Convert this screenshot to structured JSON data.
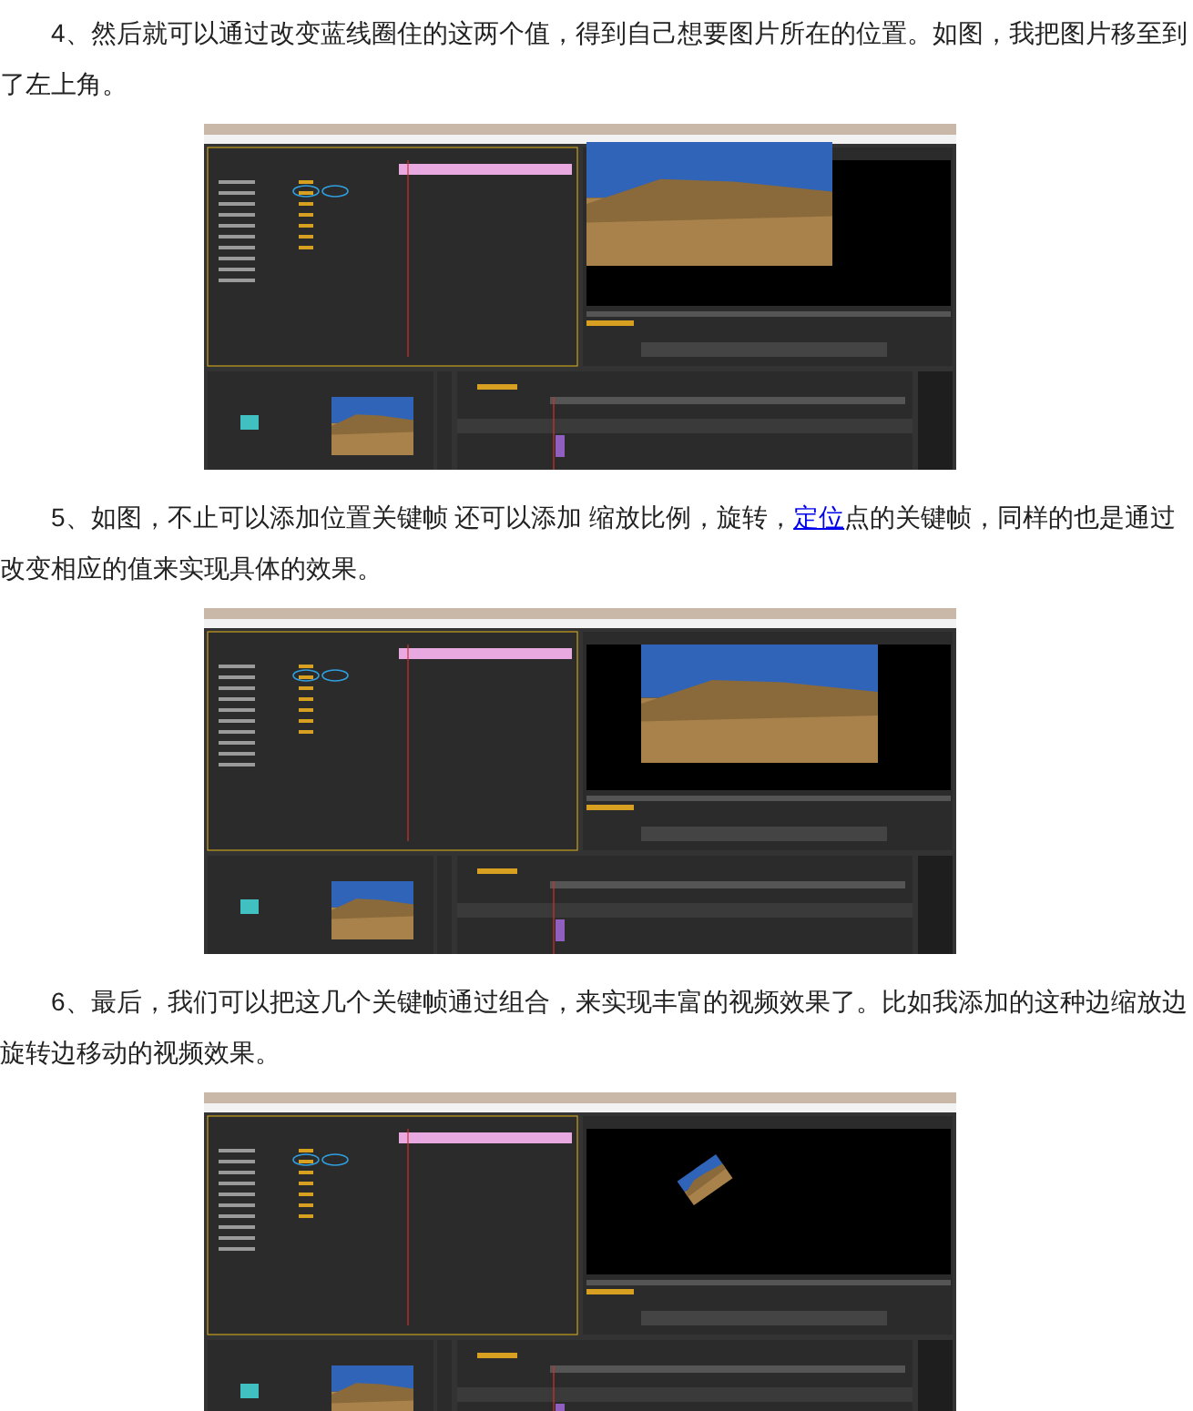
{
  "sections": [
    {
      "paragraph": {
        "before": "4、然后就可以通过改变蓝线圈住的这两个值，得到自己想要图片所在的位置。如图，我把图片移至到了左上角。"
      },
      "screenshot": {
        "kind": "corner"
      }
    },
    {
      "paragraph": {
        "before": "5、如图，不止可以添加位置关键帧 还可以添加 缩放比例，旋转，",
        "link": "定位",
        "after": "点的关键帧，同样的也是通过改变相应的值来实现具体的效果。"
      },
      "screenshot": {
        "kind": "centered"
      }
    },
    {
      "paragraph": {
        "before": "6、最后，我们可以把这几个关键帧通过组合，来实现丰富的视频效果了。比如我添加的这种边缩放边旋转边移动的视频效果。"
      },
      "screenshot": {
        "kind": "rotated"
      }
    }
  ]
}
